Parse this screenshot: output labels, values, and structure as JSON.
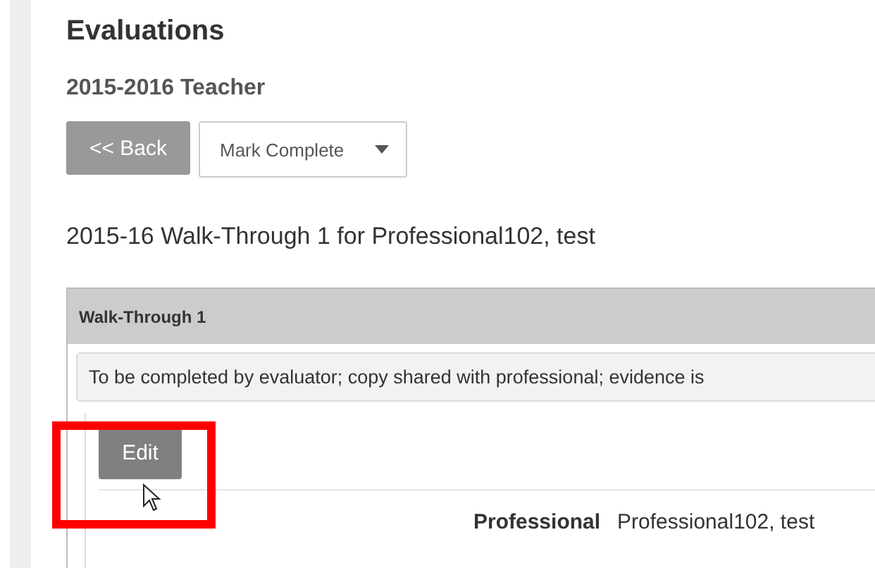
{
  "page_title": "Evaluations",
  "subtitle": "2015-2016 Teacher",
  "back_button": "<< Back",
  "status_dropdown": {
    "value": "Mark Complete"
  },
  "evaluation_title": "2015-16 Walk-Through 1 for Professional102, test",
  "panel": {
    "title": "Walk-Through 1",
    "note": "To be completed by evaluator; copy shared with professional; evidence is",
    "edit_button": "Edit",
    "fields": [
      {
        "label": "Professional",
        "value": "Professional102, test"
      }
    ]
  }
}
